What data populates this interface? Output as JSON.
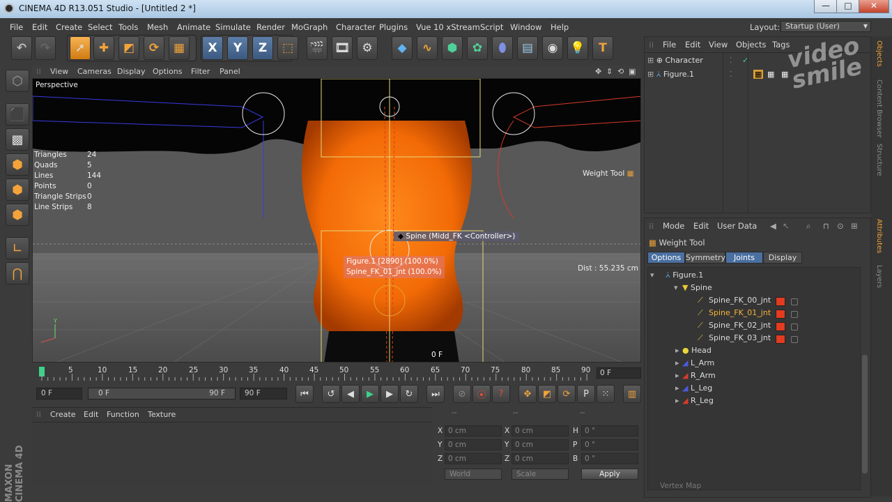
{
  "window": {
    "title": "CINEMA 4D R13.051 Studio - [Untitled 2 *]",
    "minimize": "—",
    "maximize": "□",
    "close": "✕"
  },
  "menubar": [
    "File",
    "Edit",
    "Create",
    "Select",
    "Tools",
    "Mesh",
    "Animate",
    "Simulate",
    "Render",
    "MoGraph",
    "Character",
    "Plugins",
    "Vue 10 xStream",
    "Script",
    "Window",
    "Help"
  ],
  "layout": {
    "label": "Layout:",
    "value": "Startup (User)"
  },
  "toolbar_icons": [
    "undo-icon",
    "redo-icon",
    "live-selection-icon",
    "move-icon",
    "scale-icon",
    "rotate-icon",
    "weight-brush-icon",
    "x-axis-icon",
    "y-axis-icon",
    "z-axis-icon",
    "coordinate-system-icon",
    "render-view-icon",
    "render-picture-viewer-icon",
    "render-settings-icon",
    "cube-icon",
    "spline-pen-icon",
    "subdivision-icon",
    "mograph-cloner-icon",
    "deformer-icon",
    "floor-icon",
    "camera-icon",
    "light-icon",
    "tag-icon"
  ],
  "toolbar_glyphs": {
    "x": "X",
    "y": "Y",
    "z": "Z"
  },
  "viewport": {
    "menu": [
      "View",
      "Cameras",
      "Display",
      "Options",
      "Filter",
      "Panel"
    ],
    "camera_label": "Perspective",
    "stats": [
      {
        "name": "Triangles",
        "value": "24"
      },
      {
        "name": "Quads",
        "value": "5"
      },
      {
        "name": "Lines",
        "value": "144"
      },
      {
        "name": "Points",
        "value": "0"
      },
      {
        "name": "Triangle Strips",
        "value": "0"
      },
      {
        "name": "Line Strips",
        "value": "8"
      }
    ],
    "weight_tool_label": "Weight Tool",
    "controller_tooltip": "Spine (Midd_FK <Controller>)",
    "weight_tooltip_line1": "Figure.1 [2890] (100.0%)",
    "weight_tooltip_line2": "Spine_FK_01_jnt (100.0%)",
    "distance": "Dist : 55.235 cm",
    "frame_marker": "0 F"
  },
  "timeline": {
    "ticks": [
      "0",
      "5",
      "10",
      "15",
      "20",
      "25",
      "30",
      "35",
      "40",
      "45",
      "50",
      "55",
      "60",
      "65",
      "70",
      "75",
      "80",
      "85",
      "90"
    ],
    "current_frame": "0 F",
    "start_field": "0 F",
    "range_start": "0 F",
    "range_end": "90 F",
    "end_field": "90 F"
  },
  "material_menu": [
    "Create",
    "Edit",
    "Function",
    "Texture"
  ],
  "coords": {
    "headers": [
      "--",
      "--",
      "--"
    ],
    "rows": [
      {
        "l1": "X",
        "v1": "0 cm",
        "l2": "X",
        "v2": "0 cm",
        "l3": "H",
        "v3": "0 °"
      },
      {
        "l1": "Y",
        "v1": "0 cm",
        "l2": "Y",
        "v2": "0 cm",
        "l3": "P",
        "v3": "0 °"
      },
      {
        "l1": "Z",
        "v1": "0 cm",
        "l2": "Z",
        "v2": "0 cm",
        "l3": "B",
        "v3": "0 °"
      }
    ],
    "world": "World",
    "scale": "Scale",
    "apply": "Apply"
  },
  "object_manager": {
    "menu": [
      "File",
      "Edit",
      "View",
      "Objects",
      "Tags"
    ],
    "objects": [
      "Character",
      "Figure.1"
    ]
  },
  "attributes": {
    "menu": [
      "Mode",
      "Edit",
      "User Data"
    ],
    "tool_name": "Weight Tool",
    "tabs": [
      "Options",
      "Symmetry",
      "Joints",
      "Display"
    ],
    "tree": [
      {
        "name": "Figure.1",
        "indent": 0
      },
      {
        "name": "Spine",
        "indent": 1
      },
      {
        "name": "Spine_FK_00_jnt",
        "indent": 2,
        "selected": false
      },
      {
        "name": "Spine_FK_01_jnt",
        "indent": 2,
        "selected": true
      },
      {
        "name": "Spine_FK_02_jnt",
        "indent": 2,
        "selected": false
      },
      {
        "name": "Spine_FK_03_jnt",
        "indent": 2,
        "selected": false
      },
      {
        "name": "Head",
        "indent": 1
      },
      {
        "name": "L_Arm",
        "indent": 1
      },
      {
        "name": "R_Arm",
        "indent": 1
      },
      {
        "name": "L_Leg",
        "indent": 1
      },
      {
        "name": "R_Leg",
        "indent": 1
      }
    ],
    "vertex_map": "Vertex Map"
  },
  "right_tabs": [
    "Objects",
    "Content Browser",
    "Structure",
    "Attributes",
    "Layers"
  ],
  "branding": "MAXON CINEMA 4D",
  "watermark": "video smile",
  "colors": {
    "accent": "#f2a33a",
    "joint_swatch": "#e33b1f",
    "tab_active": "#4a6fa0",
    "selected_text": "#f5b43a"
  }
}
